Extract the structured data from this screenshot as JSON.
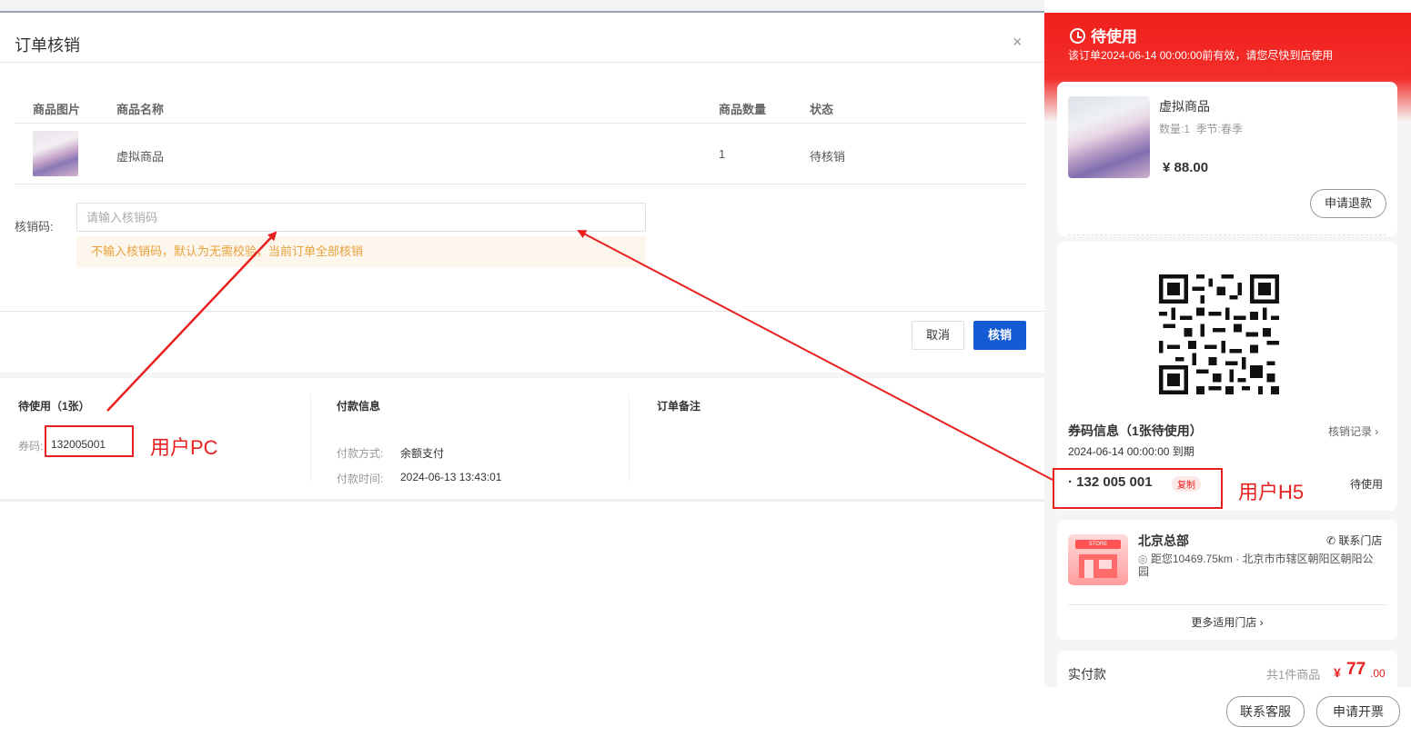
{
  "dialog": {
    "title": "订单核销",
    "close_glyph": "×",
    "table": {
      "headers": {
        "image": "商品图片",
        "name": "商品名称",
        "qty": "商品数量",
        "status": "状态"
      },
      "rows": [
        {
          "name": "虚拟商品",
          "qty": "1",
          "status": "待核销"
        }
      ]
    },
    "code_label": "核销码:",
    "code_placeholder": "请输入核销码",
    "code_value": "",
    "warning": "不输入核销码，默认为无需校验，当前订单全部核销",
    "cancel_label": "取消",
    "confirm_label": "核销"
  },
  "info": {
    "coupon_title": "待使用（1张）",
    "coupon_label": "券码:",
    "coupon_code": "132005001",
    "payment_title": "付款信息",
    "pay_method_label": "付款方式:",
    "pay_method": "余额支付",
    "pay_time_label": "付款时间:",
    "pay_time": "2024-06-13 13:43:01",
    "remark_title": "订单备注"
  },
  "annotations": {
    "pc": "用户PC",
    "h5": "用户H5",
    "color": "#e82020"
  },
  "h5": {
    "status": "待使用",
    "status_icon": "clock-icon",
    "subtitle": "该订单2024-06-14 00:00:00前有效，请您尽快到店使用",
    "product": {
      "name": "虚拟商品",
      "spec": "数量:1  季节:春季",
      "price": "¥ 88.00"
    },
    "refund_label": "申请退款",
    "coupon_info_title": "券码信息（1张待使用）",
    "record_label": "核销记录",
    "expire": "2024-06-14 00:00:00 到期",
    "code": "· 132 005 001",
    "copy_label": "复制",
    "code_status": "待使用",
    "store": {
      "name": "北京总部",
      "contact_label": "联系门店",
      "address": "距您10469.75km · 北京市市辖区朝阳区朝阳公园",
      "sign": "STORE"
    },
    "more_stores": "更多适用门店",
    "paid_label": "实付款",
    "paid_count": "共1件商品",
    "paid_currency": "¥",
    "paid_int": "77",
    "paid_dec": ".00",
    "btn_service": "联系客服",
    "btn_invoice": "申请开票",
    "brand_red": "#f0201c"
  }
}
